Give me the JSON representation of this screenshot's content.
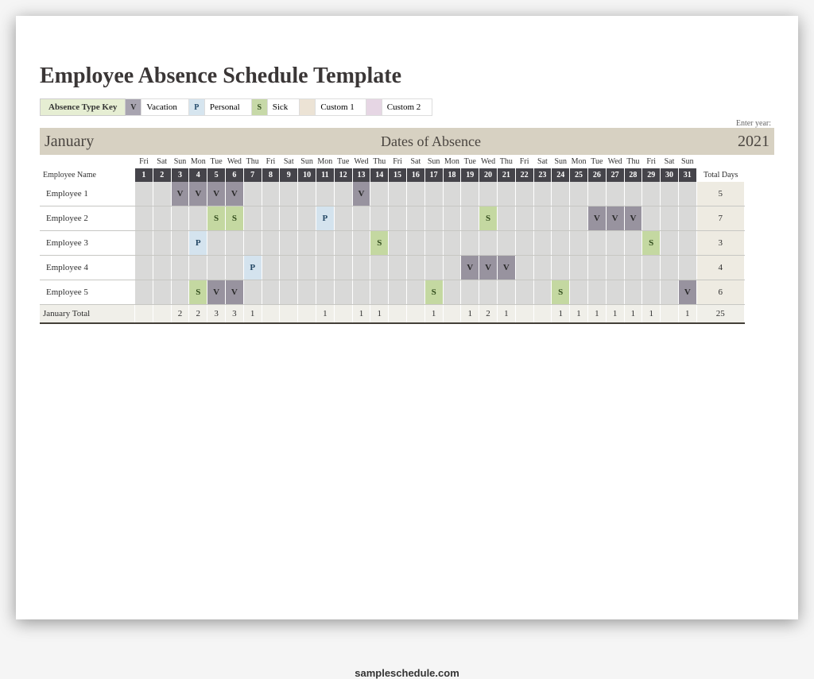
{
  "title": "Employee Absence Schedule Template",
  "legend": {
    "keyLabel": "Absence Type Key",
    "items": [
      {
        "code": "V",
        "label": "Vacation",
        "swatchClass": "v-swatch"
      },
      {
        "code": "P",
        "label": "Personal",
        "swatchClass": "p-swatch"
      },
      {
        "code": "S",
        "label": "Sick",
        "swatchClass": "s-swatch"
      },
      {
        "code": "",
        "label": "Custom 1",
        "swatchClass": "c1-swatch"
      },
      {
        "code": "",
        "label": "Custom 2",
        "swatchClass": "c2-swatch"
      }
    ]
  },
  "enterYearLabel": "Enter year:",
  "month": "January",
  "datesOfAbsenceLabel": "Dates of Absence",
  "year": "2021",
  "employeeNameHeader": "Employee Name",
  "totalDaysHeader": "Total Days",
  "dow": [
    "Fri",
    "Sat",
    "Sun",
    "Mon",
    "Tue",
    "Wed",
    "Thu",
    "Fri",
    "Sat",
    "Sun",
    "Mon",
    "Tue",
    "Wed",
    "Thu",
    "Fri",
    "Sat",
    "Sun",
    "Mon",
    "Tue",
    "Wed",
    "Thu",
    "Fri",
    "Sat",
    "Sun",
    "Mon",
    "Tue",
    "Wed",
    "Thu",
    "Fri",
    "Sat",
    "Sun"
  ],
  "dates": [
    1,
    2,
    3,
    4,
    5,
    6,
    7,
    8,
    9,
    10,
    11,
    12,
    13,
    14,
    15,
    16,
    17,
    18,
    19,
    20,
    21,
    22,
    23,
    24,
    25,
    26,
    27,
    28,
    29,
    30,
    31
  ],
  "employees": [
    {
      "name": "Employee 1",
      "total": 5,
      "days": [
        "",
        "",
        "V",
        "V",
        "V",
        "V",
        "",
        "",
        "",
        "",
        "",
        "",
        "V",
        "",
        "",
        "",
        "",
        "",
        "",
        "",
        "",
        "",
        "",
        "",
        "",
        "",
        "",
        "",
        "",
        "",
        ""
      ]
    },
    {
      "name": "Employee 2",
      "total": 7,
      "days": [
        "",
        "",
        "",
        "",
        "S",
        "S",
        "",
        "",
        "",
        "",
        "P",
        "",
        "",
        "",
        "",
        "",
        "",
        "",
        "",
        "S",
        "",
        "",
        "",
        "",
        "",
        "V",
        "V",
        "V",
        "",
        "",
        ""
      ]
    },
    {
      "name": "Employee 3",
      "total": 3,
      "days": [
        "",
        "",
        "",
        "P",
        "",
        "",
        "",
        "",
        "",
        "",
        "",
        "",
        "",
        "S",
        "",
        "",
        "",
        "",
        "",
        "",
        "",
        "",
        "",
        "",
        "",
        "",
        "",
        "",
        "S",
        "",
        ""
      ]
    },
    {
      "name": "Employee 4",
      "total": 4,
      "days": [
        "",
        "",
        "",
        "",
        "",
        "",
        "P",
        "",
        "",
        "",
        "",
        "",
        "",
        "",
        "",
        "",
        "",
        "",
        "V",
        "V",
        "V",
        "",
        "",
        "",
        "",
        "",
        "",
        "",
        "",
        "",
        ""
      ]
    },
    {
      "name": "Employee 5",
      "total": 6,
      "days": [
        "",
        "",
        "",
        "S",
        "V",
        "V",
        "",
        "",
        "",
        "",
        "",
        "",
        "",
        "",
        "",
        "",
        "S",
        "",
        "",
        "",
        "",
        "",
        "",
        "S",
        "",
        "",
        "",
        "",
        "",
        "",
        "V"
      ]
    }
  ],
  "totalsRow": {
    "label": "January Total",
    "grandTotal": 25,
    "days": [
      "",
      "",
      "2",
      "2",
      "3",
      "3",
      "1",
      "",
      "",
      "",
      "1",
      "",
      "1",
      "1",
      "",
      "",
      "1",
      "",
      "1",
      "2",
      "1",
      "",
      "",
      "1",
      "1",
      "1",
      "1",
      "1",
      "1",
      "",
      "1"
    ]
  },
  "watermark": "sampleschedule.com"
}
